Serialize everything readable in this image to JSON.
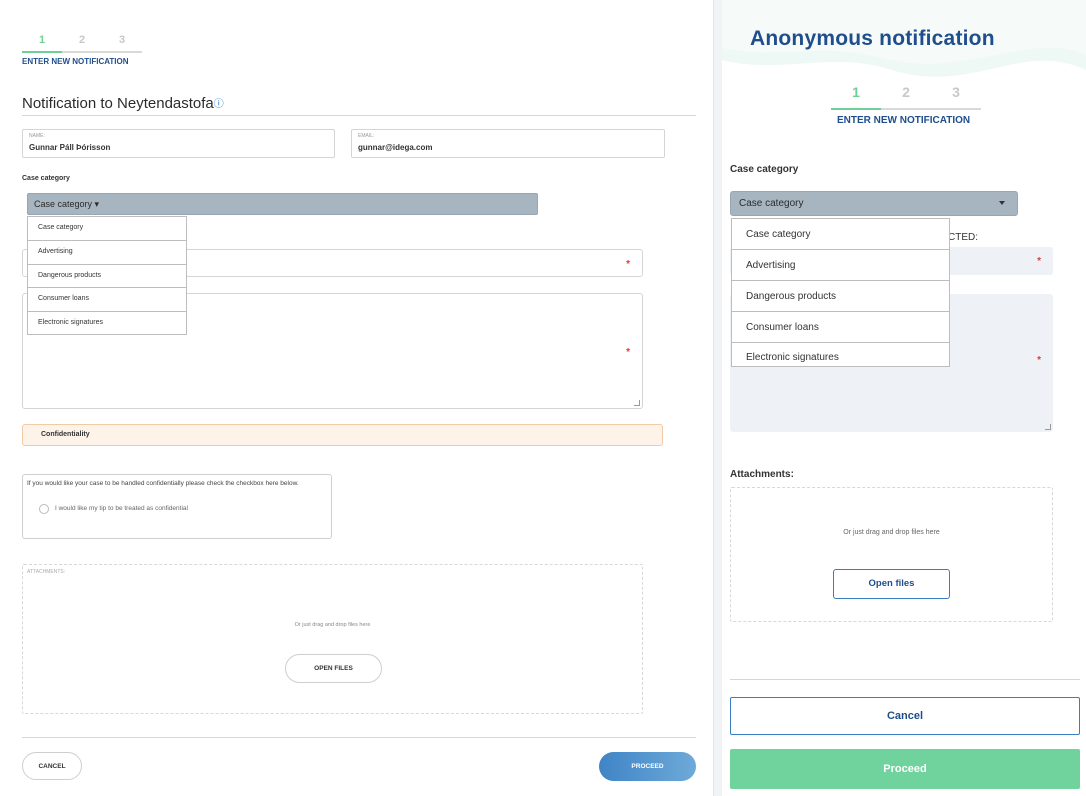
{
  "left": {
    "steps": [
      "1",
      "2",
      "3"
    ],
    "step_caption": "ENTER NEW NOTIFICATION",
    "title": "Notification to Neytendastofa",
    "info_icon": "ⓘ",
    "name_label": "NAME:",
    "name_value": "Gunnar Páll Þórisson",
    "email_label": "EMAIL:",
    "email_value": "gunnar@idega.com",
    "case_category_label": "Case category",
    "select_value": "Case category ▾",
    "dropdown_options": [
      "Case category",
      "Advertising",
      "Dangerous products",
      "Consumer loans",
      "Electronic signatures"
    ],
    "required_mark": "*",
    "confidentiality_title": "Confidentiality",
    "confidential_text": "If you would like your case to be handled confidentially please check the checkbox here below.",
    "confidential_option": "I would like my tip to be treated as confidential",
    "attachments_label": "ATTACHMENTS:",
    "drag_drop_text": "Or just drag and drop files here",
    "open_files": "OPEN FILES",
    "cancel": "CANCEL",
    "proceed": "PROCEED"
  },
  "right": {
    "title": "Anonymous notification",
    "steps": [
      "1",
      "2",
      "3"
    ],
    "step_caption": "ENTER NEW NOTIFICATION",
    "case_category_label": "Case category",
    "select_value": "Case category",
    "partial_hidden_label": "CTED:",
    "dropdown_options": [
      "Case category",
      "Advertising",
      "Dangerous products",
      "Consumer loans",
      "Electronic signatures"
    ],
    "required_mark": "*",
    "attachments_label": "Attachments:",
    "drag_drop_text": "Or just drag and drop files here",
    "open_files": "Open files",
    "cancel": "Cancel",
    "proceed": "Proceed"
  },
  "colors": {
    "accent_green": "#70d29c",
    "brand_blue": "#1f4e8c",
    "select_grey": "#a7b5c0",
    "required_red": "#e03a3a"
  }
}
